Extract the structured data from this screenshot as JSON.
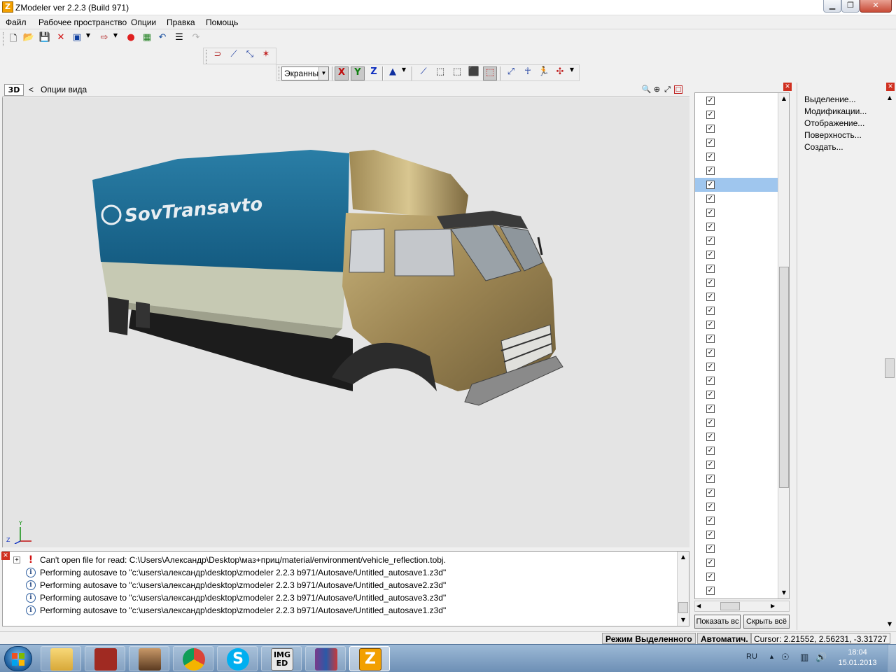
{
  "window": {
    "title": "ZModeler ver 2.2.3 (Build 971)",
    "app_icon": "Z"
  },
  "menu": [
    "Файл",
    "Рабочее пространство",
    "Опции",
    "Правка",
    "Помощь"
  ],
  "toolbar": {
    "view_mode": "Экранный",
    "axes": [
      "X",
      "Y",
      "Z"
    ]
  },
  "viewport": {
    "mode_label": "3D",
    "back_label": "<",
    "options_label": "Опции вида",
    "model_text": "SovTransavto",
    "axis_labels": {
      "y": "Y",
      "z": "Z"
    }
  },
  "log": {
    "entries": [
      {
        "type": "error",
        "text": "Can't open file for read: C:\\Users\\Александр\\Desktop\\маз+приц/material/environment/vehicle_reflection.tobj."
      },
      {
        "type": "info",
        "text": "Performing autosave to \"c:\\users\\александр\\desktop\\zmodeler 2.2.3 b971/Autosave/Untitled_autosave1.z3d\""
      },
      {
        "type": "info",
        "text": "Performing autosave to \"c:\\users\\александр\\desktop\\zmodeler 2.2.3 b971/Autosave/Untitled_autosave2.z3d\""
      },
      {
        "type": "info",
        "text": "Performing autosave to \"c:\\users\\александр\\desktop\\zmodeler 2.2.3 b971/Autosave/Untitled_autosave3.z3d\""
      },
      {
        "type": "info",
        "text": "Performing autosave to \"c:\\users\\александр\\desktop\\zmodeler 2.2.3 b971/Autosave/Untitled_autosave1.z3d\""
      }
    ]
  },
  "objects": {
    "count": 36,
    "selected_index": 6
  },
  "object_panel": {
    "show_all": "Показать вс",
    "hide_all": "Скрыть всё"
  },
  "commands": [
    "Выделение...",
    "Модификации...",
    "Отображение...",
    "Поверхность...",
    "Создать..."
  ],
  "status": {
    "mode": "Режим Выделенного",
    "auto": "Автоматич.",
    "cursor": "Cursor: 2.21552, 2.56231, -3.31727"
  },
  "taskbar": {
    "apps": [
      "explorer",
      "winrar-red",
      "game-character",
      "chrome",
      "skype",
      "img-editor",
      "winrar",
      "zmodeler"
    ],
    "img_label": "IMG",
    "img_sub": "ED",
    "language": "RU",
    "time": "18:04",
    "date": "15.01.2013"
  }
}
